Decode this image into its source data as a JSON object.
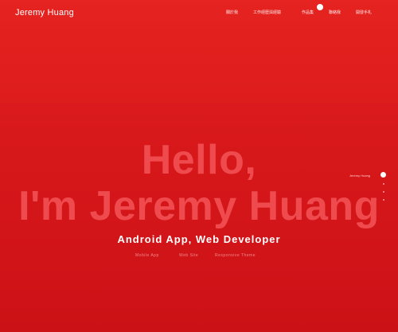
{
  "header": {
    "brand": "Jeremy Huang",
    "nav": [
      {
        "label": "關於我"
      },
      {
        "label": "工作經歷與經驗"
      },
      {
        "label": "作品集"
      },
      {
        "label": "聯絡我"
      },
      {
        "label": "開發手札"
      }
    ]
  },
  "hero": {
    "title_line1": "Hello,",
    "title_line2": "I'm Jeremy Huang",
    "subtitle": "Android App, Web Developer",
    "tags": [
      "Mobile App",
      "Web Site",
      "Responsive Theme"
    ],
    "side_label": "Jeremy Huang"
  },
  "colors": {
    "background": "#d8191c",
    "title": "#ef4a4e",
    "text": "#ffffff"
  }
}
